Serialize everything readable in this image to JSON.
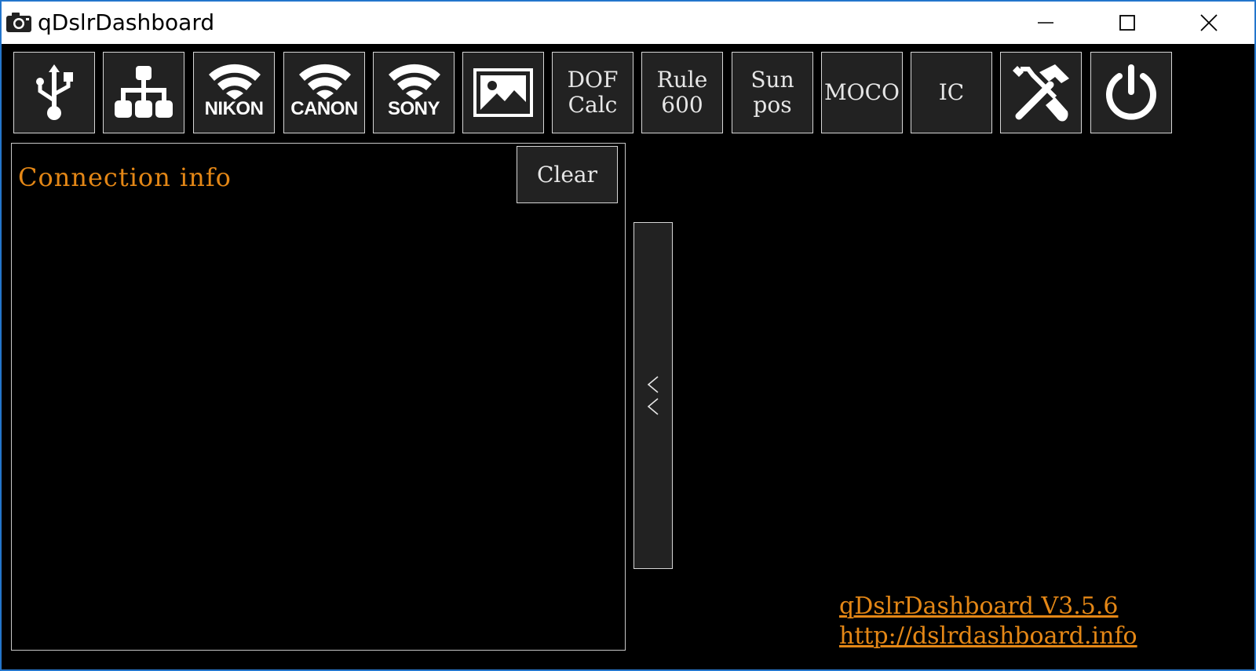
{
  "window": {
    "title": "qDslrDashboard",
    "controls": [
      "minimize",
      "maximize",
      "close"
    ]
  },
  "toolbar": {
    "buttons": [
      {
        "name": "usb",
        "icon": "usb-icon"
      },
      {
        "name": "network",
        "icon": "network-tree-icon"
      },
      {
        "name": "nikon",
        "icon": "wifi-icon",
        "label": "NIKON"
      },
      {
        "name": "canon",
        "icon": "wifi-icon",
        "label": "CANON"
      },
      {
        "name": "sony",
        "icon": "wifi-icon",
        "label": "SONY"
      },
      {
        "name": "image",
        "icon": "image-icon"
      },
      {
        "name": "dof",
        "label": "DOF\nCalc"
      },
      {
        "name": "rule600",
        "label": "Rule\n600"
      },
      {
        "name": "sunpos",
        "label": "Sun\npos"
      },
      {
        "name": "moco",
        "label": "MOCO"
      },
      {
        "name": "ic",
        "label": "IC"
      },
      {
        "name": "settings",
        "icon": "tools-icon"
      },
      {
        "name": "power",
        "icon": "power-icon"
      }
    ]
  },
  "log": {
    "text": "Connection info",
    "clear_label": "Clear"
  },
  "collapse": {
    "icon": "double-chevron-left-icon"
  },
  "footer": {
    "version": "qDslrDashboard V3.5.6",
    "url": "http://dslrdashboard.info"
  },
  "colors": {
    "accent": "#e48716",
    "button_bg": "#222222",
    "border": "#d6d6d6"
  }
}
